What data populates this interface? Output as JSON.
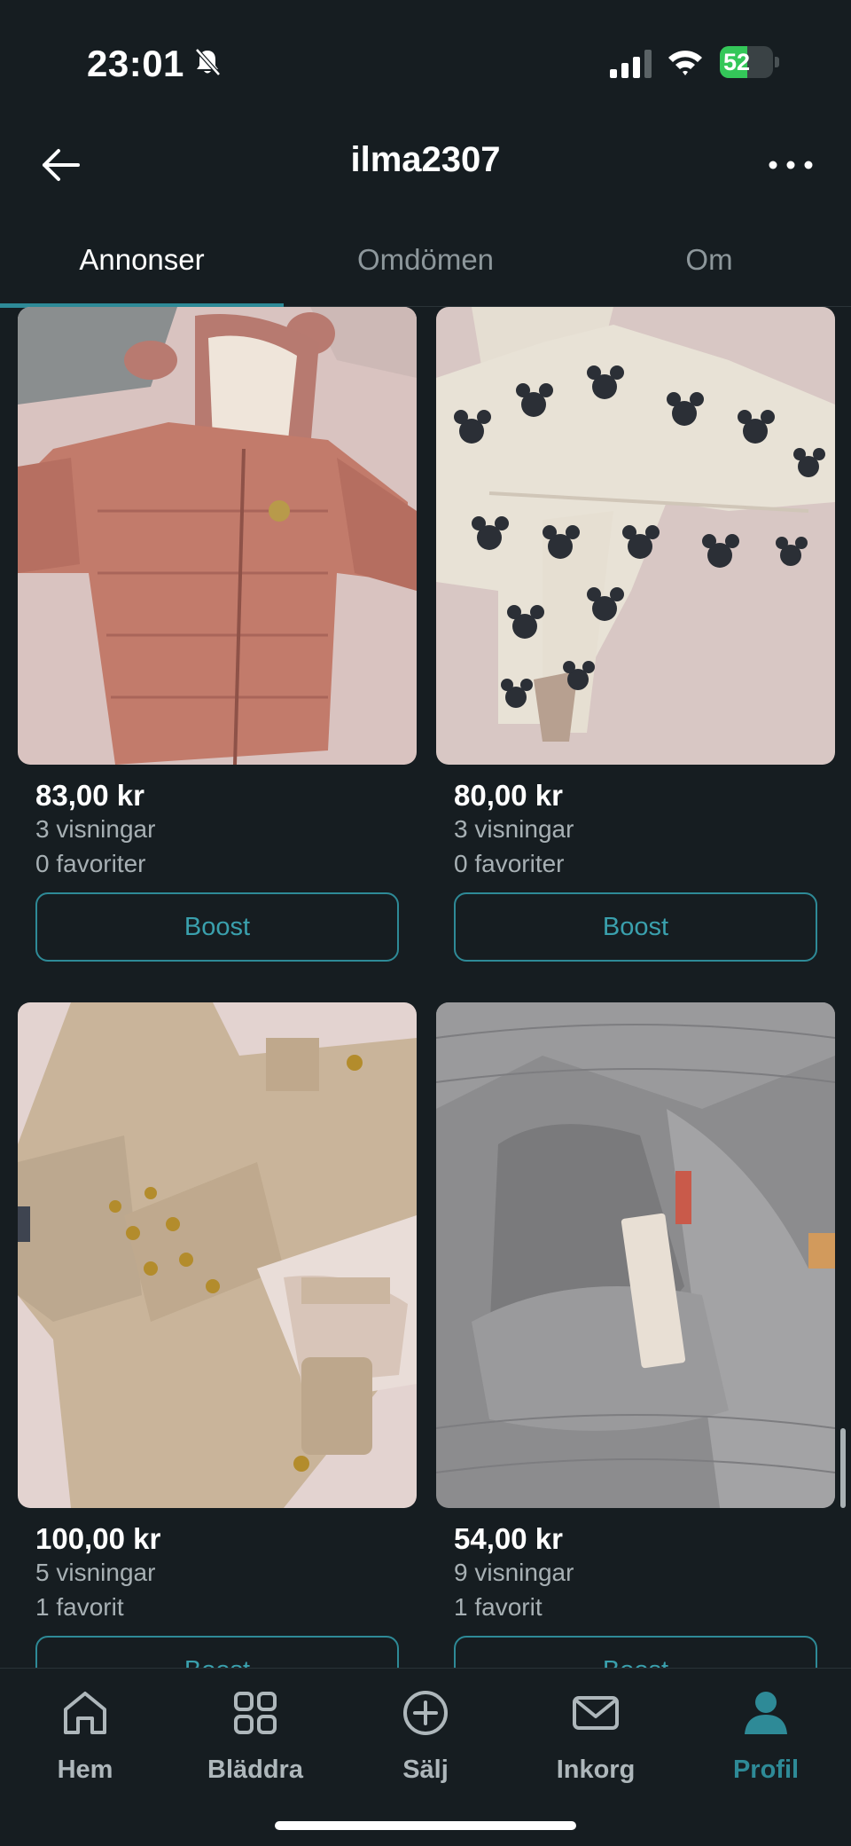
{
  "status_bar": {
    "time": "23:01",
    "battery": "52",
    "battery_level": 0.52
  },
  "header": {
    "title": "ilma2307"
  },
  "tabs": [
    {
      "label": "Annonser",
      "active": true
    },
    {
      "label": "Omdömen",
      "active": false
    },
    {
      "label": "Om",
      "active": false
    }
  ],
  "listings": [
    {
      "price": "83,00 kr",
      "views": "3 visningar",
      "favorites": "0 favoriter",
      "boost_label": "Boost",
      "image": "pink-puffer-snowsuit"
    },
    {
      "price": "80,00 kr",
      "views": "3 visningar",
      "favorites": "0 favoriter",
      "boost_label": "Boost",
      "image": "mickey-print-fleece-suit"
    },
    {
      "price": "100,00 kr",
      "views": "5 visningar",
      "favorites": "1 favorit",
      "boost_label": "Boost",
      "image": "beige-wool-coat-suit"
    },
    {
      "price": "54,00 kr",
      "views": "9 visningar",
      "favorites": "1 favorit",
      "boost_label": "Boost",
      "image": "grey-knit-cardigan"
    }
  ],
  "bottom_nav": [
    {
      "label": "Hem",
      "icon": "home-icon",
      "active": false
    },
    {
      "label": "Bläddra",
      "icon": "grid-icon",
      "active": false
    },
    {
      "label": "Sälj",
      "icon": "plus-circle-icon",
      "active": false
    },
    {
      "label": "Inkorg",
      "icon": "envelope-icon",
      "active": false
    },
    {
      "label": "Profil",
      "icon": "person-icon",
      "active": true
    }
  ],
  "colors": {
    "background": "#161d21",
    "accent": "#2e8a97",
    "battery_green": "#34c759"
  }
}
